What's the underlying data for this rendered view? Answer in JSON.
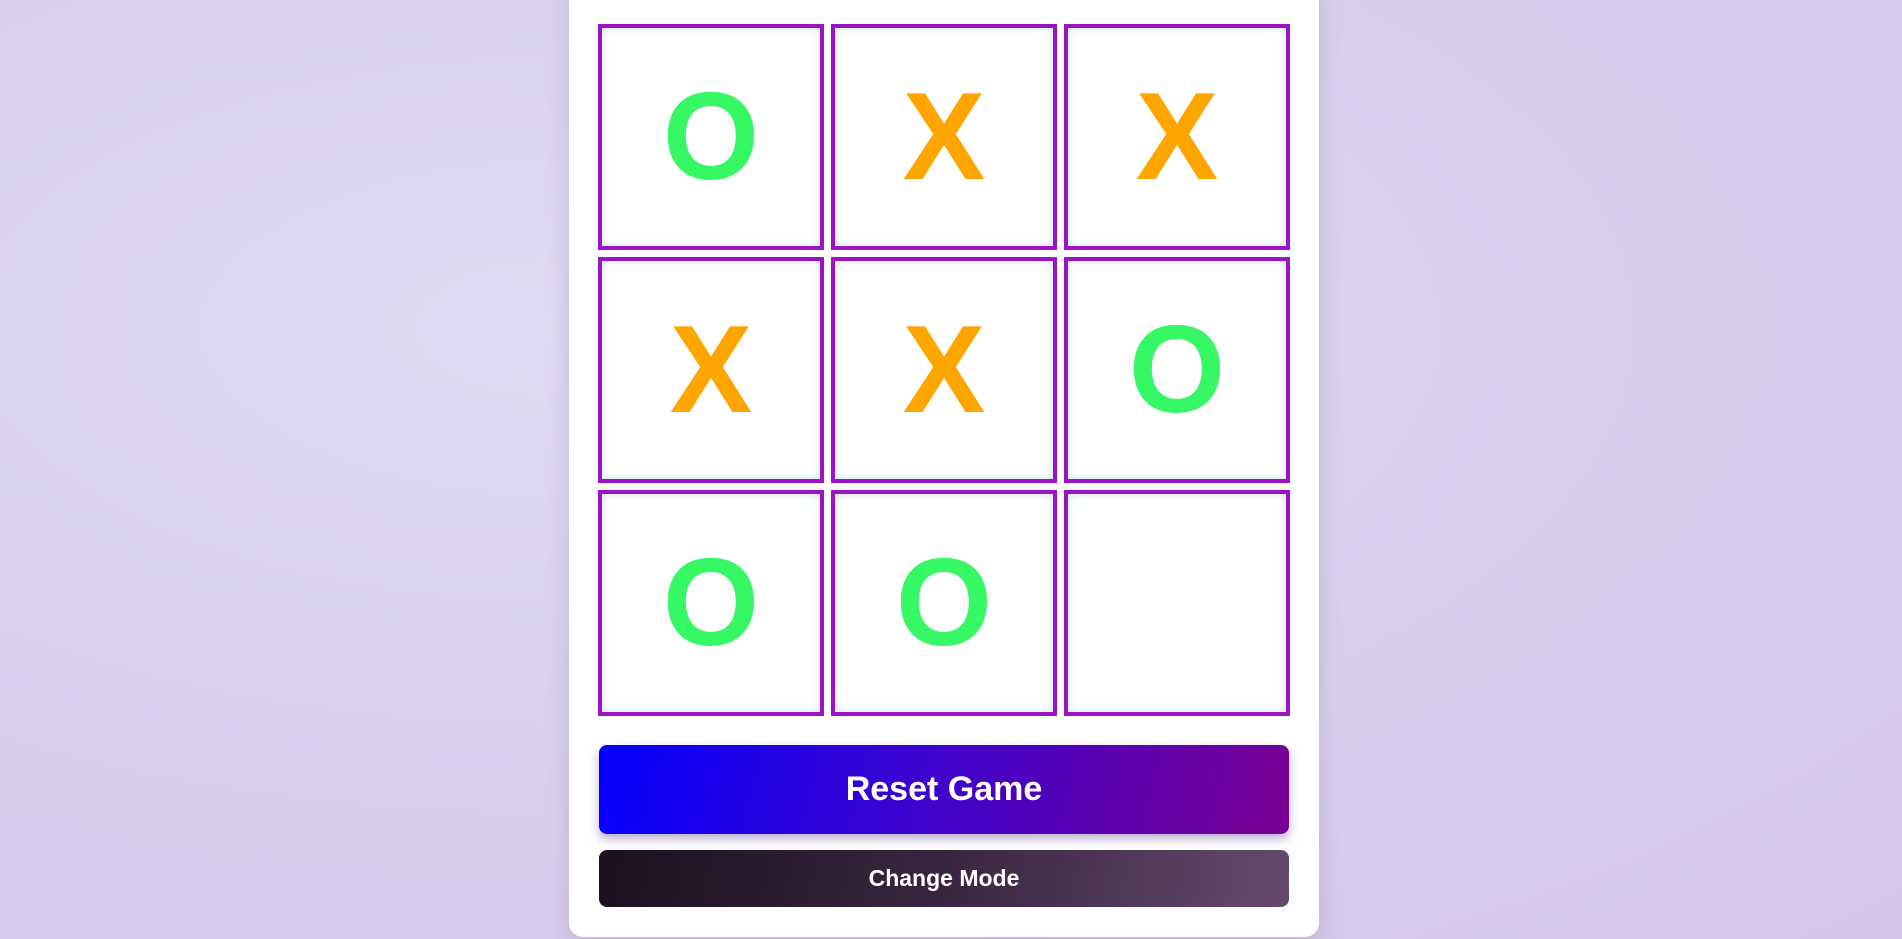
{
  "board": {
    "cells": [
      {
        "mark": "O",
        "kind": "mark-o"
      },
      {
        "mark": "X",
        "kind": "mark-x"
      },
      {
        "mark": "X",
        "kind": "mark-x"
      },
      {
        "mark": "X",
        "kind": "mark-x"
      },
      {
        "mark": "X",
        "kind": "mark-x"
      },
      {
        "mark": "O",
        "kind": "mark-o"
      },
      {
        "mark": "O",
        "kind": "mark-o"
      },
      {
        "mark": "O",
        "kind": "mark-o"
      },
      {
        "mark": "",
        "kind": "empty"
      }
    ]
  },
  "controls": {
    "reset_label": "Reset Game",
    "mode_label": "Change Mode"
  },
  "colors": {
    "x_mark": "#ffa500",
    "o_mark": "#36f865",
    "cell_border": "#9b12c7",
    "reset_gradient_start": "#0500ff",
    "reset_gradient_end": "#7a0093",
    "mode_gradient_start": "#1b1020",
    "mode_gradient_end": "#654a6c"
  }
}
